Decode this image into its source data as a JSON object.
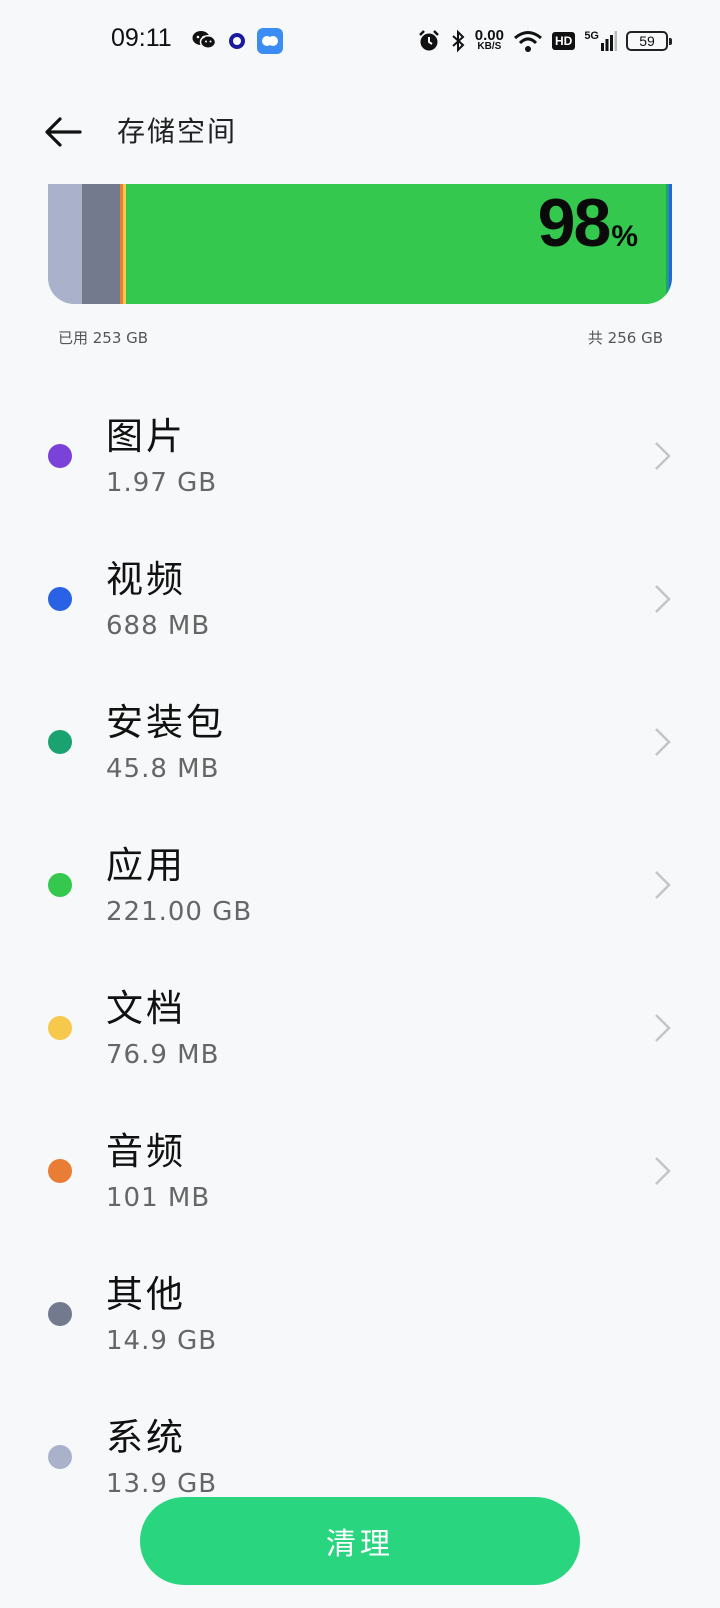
{
  "status_bar": {
    "time": "09:11",
    "net_speed": "0.00",
    "net_unit": "KB/S",
    "hd": "HD",
    "signal": "5G",
    "battery": "59"
  },
  "header": {
    "title": "存储空间"
  },
  "storage": {
    "percent": "98",
    "percent_symbol": "%",
    "used_label": "已用 253 GB",
    "total_label": "共 256 GB",
    "segments": [
      {
        "color": "#a9b2ca",
        "fraction": 0.055
      },
      {
        "color": "#737a8e",
        "fraction": 0.06
      },
      {
        "color": "#e97d35",
        "fraction": 0.005
      },
      {
        "color": "#f6c94c",
        "fraction": 0.005
      },
      {
        "color": "#34c84e",
        "fraction": 0.866
      },
      {
        "color": "#1ba271",
        "fraction": 0.004
      },
      {
        "color": "#2a62e6",
        "fraction": 0.005
      }
    ]
  },
  "categories": [
    {
      "name": "图片",
      "size": "1.97 GB",
      "color": "#7a42d8",
      "chevron": true
    },
    {
      "name": "视频",
      "size": "688 MB",
      "color": "#2a62e6",
      "chevron": true
    },
    {
      "name": "安装包",
      "size": "45.8 MB",
      "color": "#1ba271",
      "chevron": true
    },
    {
      "name": "应用",
      "size": "221.00  GB",
      "color": "#34c84e",
      "chevron": true
    },
    {
      "name": "文档",
      "size": "76.9 MB",
      "color": "#f6c94c",
      "chevron": true
    },
    {
      "name": "音频",
      "size": "101 MB",
      "color": "#e97d35",
      "chevron": true
    },
    {
      "name": "其他",
      "size": "14.9 GB",
      "color": "#737a8e",
      "chevron": false
    },
    {
      "name": "系统",
      "size": "13.9 GB",
      "color": "#a9b2ca",
      "chevron": false
    }
  ],
  "clean_button": {
    "label": "清理"
  }
}
